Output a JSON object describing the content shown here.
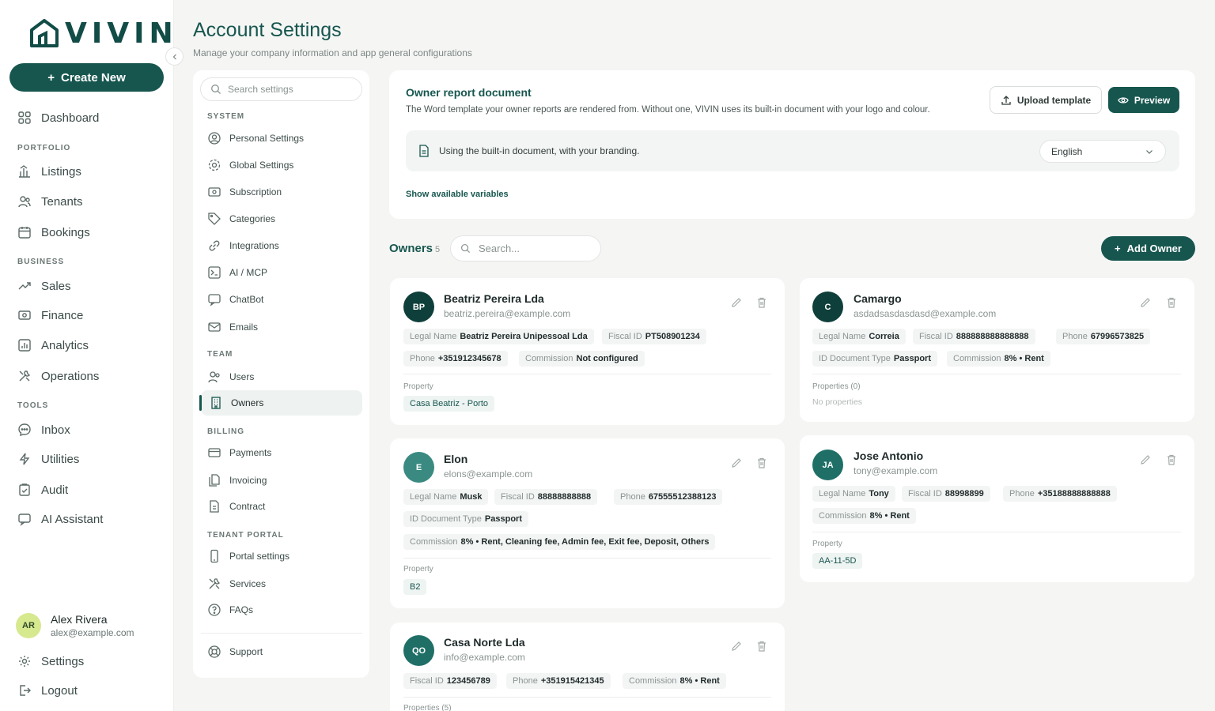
{
  "app": {
    "brand": "VIVIN",
    "colors": {
      "primary": "#17564f",
      "accent": "#d6e98f",
      "background": "#f5f6f4"
    }
  },
  "sidebar": {
    "create_label": "Create New",
    "dashboard": "Dashboard",
    "sections": {
      "portfolio": "PORTFOLIO",
      "business": "BUSINESS",
      "tools": "TOOLS"
    },
    "items": {
      "listings": "Listings",
      "tenants": "Tenants",
      "bookings": "Bookings",
      "sales": "Sales",
      "finance": "Finance",
      "analytics": "Analytics",
      "operations": "Operations",
      "inbox": "Inbox",
      "utilities": "Utilities",
      "audit": "Audit",
      "ai_assistant": "AI Assistant"
    },
    "user": {
      "initials": "AR",
      "name": "Alex Rivera",
      "email": "alex@example.com"
    },
    "settings": "Settings",
    "logout": "Logout"
  },
  "page": {
    "title": "Account Settings",
    "subtitle": "Manage your company information and app general configurations"
  },
  "settings_nav": {
    "search_placeholder": "Search settings",
    "sections": {
      "system": "SYSTEM",
      "team": "TEAM",
      "billing": "BILLING",
      "tenant_portal": "TENANT PORTAL"
    },
    "items": {
      "personal": "Personal Settings",
      "global": "Global Settings",
      "subscription": "Subscription",
      "categories": "Categories",
      "integrations": "Integrations",
      "ai_mcp": "AI / MCP",
      "chatbot": "ChatBot",
      "emails": "Emails",
      "users": "Users",
      "owners": "Owners",
      "payments": "Payments",
      "invoicing": "Invoicing",
      "contract": "Contract",
      "portal": "Portal settings",
      "services": "Services",
      "faqs": "FAQs",
      "support": "Support"
    }
  },
  "report": {
    "title": "Owner report document",
    "description": "The Word template your owner reports are rendered from. Without one, VIVIN uses its built-in document with your logo and colour.",
    "upload_label": "Upload template",
    "preview_label": "Preview",
    "status": "Using the built-in document, with your branding.",
    "language": "English",
    "show_vars": "Show available variables"
  },
  "owners": {
    "title": "Owners",
    "count": "5",
    "search_placeholder": "Search...",
    "add_label": "Add Owner",
    "labels": {
      "legal": "Legal Name",
      "fiscal": "Fiscal ID",
      "phone": "Phone",
      "commission": "Commission",
      "id_doc": "ID Document Type",
      "property": "Property",
      "properties0": "Properties (0)",
      "properties5": "Properties (5)",
      "no_props": "No properties"
    },
    "cards": [
      {
        "initials": "BP",
        "name": "Beatriz Pereira Lda",
        "email": "beatriz.pereira@example.com",
        "legal": "Beatriz Pereira Unipessoal Lda",
        "fiscal": "PT508901234",
        "phone": "+351912345678",
        "commission": "Not configured",
        "property": "Casa Beatriz - Porto"
      },
      {
        "initials": "C",
        "name": "Camargo",
        "email": "asdadsasdasdasd@example.com",
        "legal": "Correia",
        "fiscal": "888888888888888",
        "phone": "67996573825",
        "id_doc": "Passport",
        "commission": "8% • Rent"
      },
      {
        "initials": "E",
        "name": "Elon",
        "email": "elons@example.com",
        "legal": "Musk",
        "fiscal": "88888888888",
        "phone": "67555512388123",
        "id_doc": "Passport",
        "commission": "8% • Rent, Cleaning fee, Admin fee, Exit fee, Deposit, Others",
        "property": "B2"
      },
      {
        "initials": "JA",
        "name": "Jose Antonio",
        "email": "tony@example.com",
        "legal": "Tony",
        "fiscal": "88998899",
        "phone": "+35188888888888",
        "commission": "8% • Rent",
        "property": "AA-11-5D"
      },
      {
        "initials": "QO",
        "name": "Casa Norte Lda",
        "email": "info@example.com",
        "fiscal": "123456789",
        "phone": "+351915421345",
        "commission": "8% • Rent"
      }
    ]
  }
}
